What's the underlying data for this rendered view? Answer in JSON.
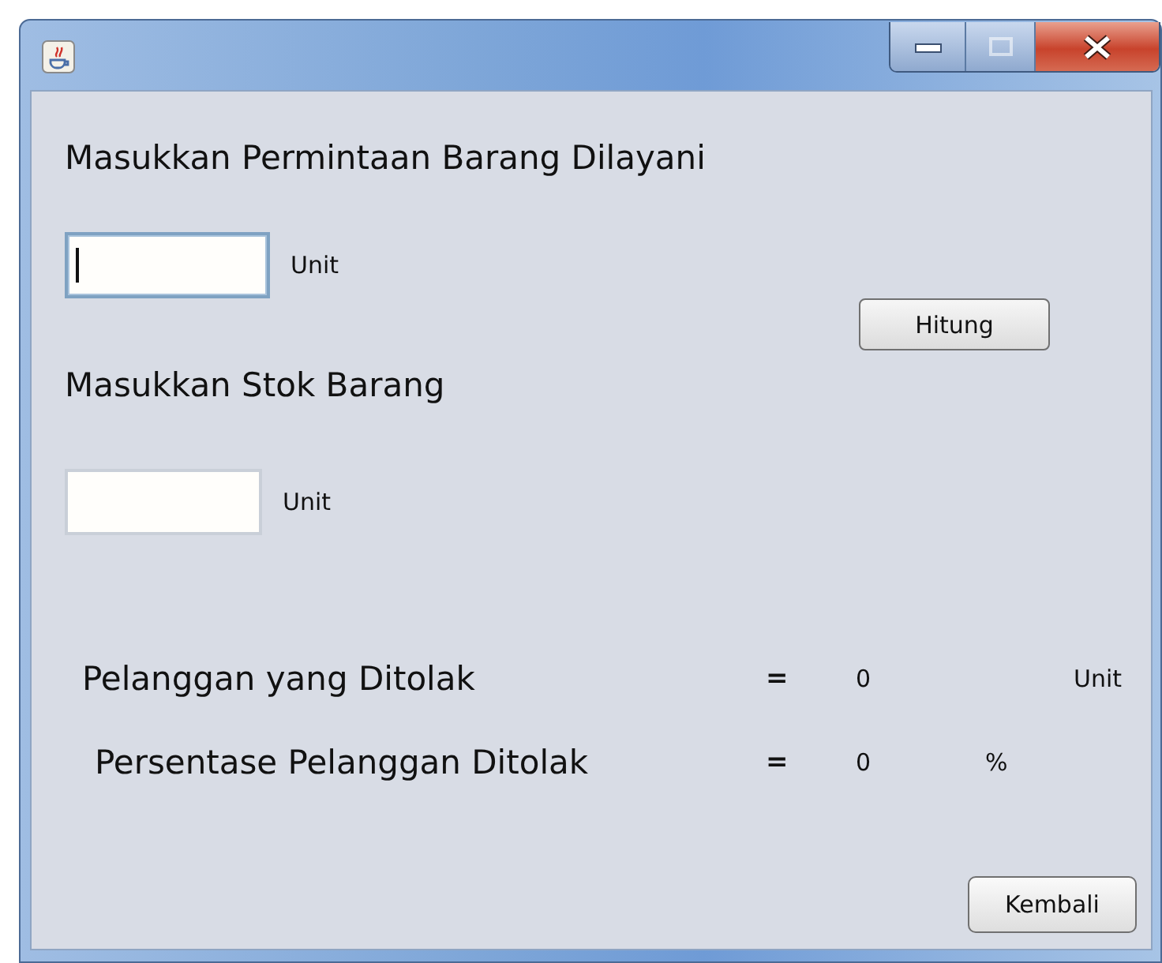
{
  "window": {
    "controls": [
      {
        "kind": "minimize"
      },
      {
        "kind": "maximize",
        "disabled": true
      },
      {
        "kind": "close"
      }
    ]
  },
  "inputs": [
    {
      "heading": "Masukkan Permintaan Barang Dilayani",
      "focused": true,
      "unit": "Unit"
    },
    {
      "heading": "Masukkan Stok Barang",
      "focused": false,
      "unit": "Unit"
    }
  ],
  "hitung_button": "Hitung",
  "results": [
    {
      "label": "Pelanggan yang Ditolak",
      "equals": "=",
      "value": "0",
      "unit": "Unit"
    },
    {
      "label": "Persentase Pelanggan Ditolak",
      "equals": "=",
      "value": "0",
      "unit": "%"
    }
  ],
  "back_button": "Kembali"
}
